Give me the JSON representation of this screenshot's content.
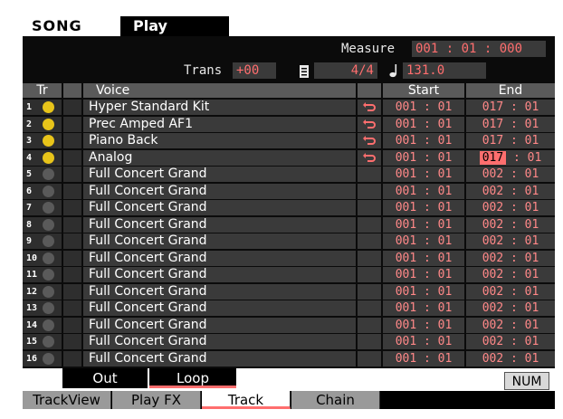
{
  "title": {
    "mode": "SONG",
    "screen": "Play"
  },
  "measure": {
    "label": "Measure",
    "value": "001 : 01 : 000"
  },
  "trans": {
    "label": "Trans",
    "value": "+00"
  },
  "time_signature": {
    "icon": "metronome-icon",
    "value": "4/4"
  },
  "tempo": {
    "icon": "quarter-note-icon",
    "value": "131.0"
  },
  "columns": {
    "tr": "Tr",
    "voice": "Voice",
    "start": "Start",
    "end": "End"
  },
  "colors": {
    "accent": "#ff6e6e",
    "active_dot": "#e8c41a",
    "inactive_dot": "#5a5a5a"
  },
  "tracks": [
    {
      "num": "1",
      "active": true,
      "voice": "Hyper Standard Kit",
      "loop": true,
      "start": "001 : 01",
      "end": "017 : 01"
    },
    {
      "num": "2",
      "active": true,
      "voice": "Prec Amped AF1",
      "loop": true,
      "start": "001 : 01",
      "end": "017 : 01"
    },
    {
      "num": "3",
      "active": true,
      "voice": "Piano Back",
      "loop": true,
      "start": "001 : 01",
      "end": "017 : 01"
    },
    {
      "num": "4",
      "active": true,
      "voice": "Analog",
      "loop": true,
      "start": "001 : 01",
      "end": "017 : 01",
      "highlight_end": true
    },
    {
      "num": "5",
      "active": false,
      "voice": "Full Concert Grand",
      "loop": false,
      "start": "001 : 01",
      "end": "002 : 01"
    },
    {
      "num": "6",
      "active": false,
      "voice": "Full Concert Grand",
      "loop": false,
      "start": "001 : 01",
      "end": "002 : 01"
    },
    {
      "num": "7",
      "active": false,
      "voice": "Full Concert Grand",
      "loop": false,
      "start": "001 : 01",
      "end": "002 : 01"
    },
    {
      "num": "8",
      "active": false,
      "voice": "Full Concert Grand",
      "loop": false,
      "start": "001 : 01",
      "end": "002 : 01"
    },
    {
      "num": "9",
      "active": false,
      "voice": "Full Concert Grand",
      "loop": false,
      "start": "001 : 01",
      "end": "002 : 01"
    },
    {
      "num": "10",
      "active": false,
      "voice": "Full Concert Grand",
      "loop": false,
      "start": "001 : 01",
      "end": "002 : 01"
    },
    {
      "num": "11",
      "active": false,
      "voice": "Full Concert Grand",
      "loop": false,
      "start": "001 : 01",
      "end": "002 : 01"
    },
    {
      "num": "12",
      "active": false,
      "voice": "Full Concert Grand",
      "loop": false,
      "start": "001 : 01",
      "end": "002 : 01"
    },
    {
      "num": "13",
      "active": false,
      "voice": "Full Concert Grand",
      "loop": false,
      "start": "001 : 01",
      "end": "002 : 01"
    },
    {
      "num": "14",
      "active": false,
      "voice": "Full Concert Grand",
      "loop": false,
      "start": "001 : 01",
      "end": "002 : 01"
    },
    {
      "num": "15",
      "active": false,
      "voice": "Full Concert Grand",
      "loop": false,
      "start": "001 : 01",
      "end": "002 : 01"
    },
    {
      "num": "16",
      "active": false,
      "voice": "Full Concert Grand",
      "loop": false,
      "start": "001 : 01",
      "end": "002 : 01"
    }
  ],
  "bottom_buttons": {
    "out": "Out",
    "loop": "Loop",
    "num": "NUM"
  },
  "tabs": [
    {
      "label": "TrackView",
      "active": false
    },
    {
      "label": "Play FX",
      "active": false
    },
    {
      "label": "Track",
      "active": true
    },
    {
      "label": "Chain",
      "active": false
    }
  ]
}
